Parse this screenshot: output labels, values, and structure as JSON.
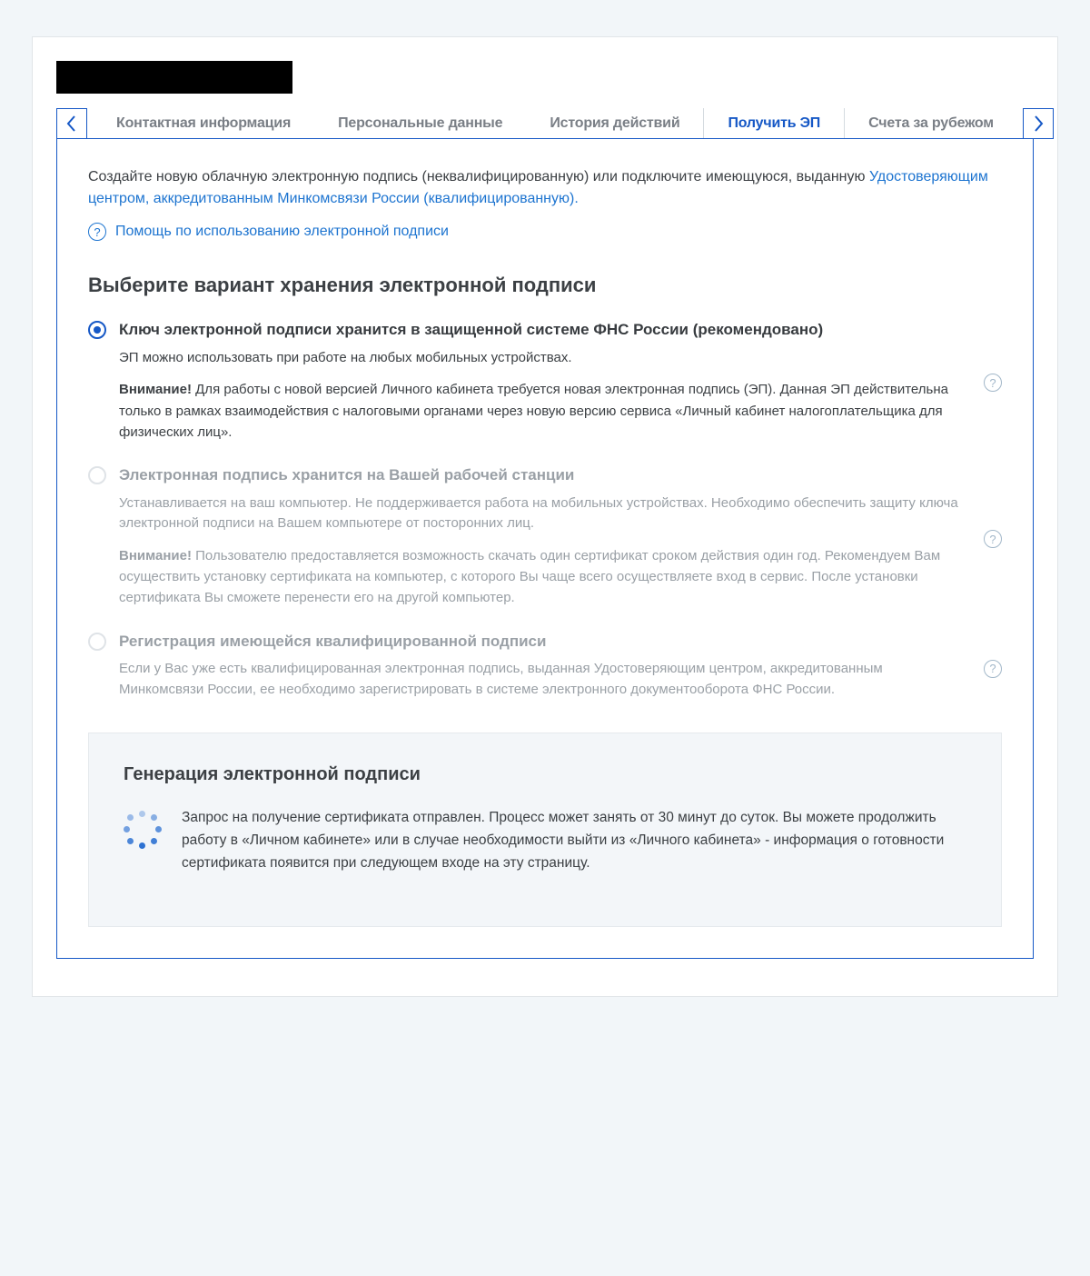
{
  "tabs": {
    "items": [
      {
        "label": "Контактная информация",
        "active": false
      },
      {
        "label": "Персональные данные",
        "active": false
      },
      {
        "label": "История действий",
        "active": false
      },
      {
        "label": "Получить ЭП",
        "active": true
      },
      {
        "label": "Счета за рубежом",
        "active": false
      }
    ]
  },
  "intro": {
    "text1": "Создайте новую облачную электронную подпись (неквалифицированную) или подключите имеющуюся, выданную ",
    "link": "Удостоверяющим центром, аккредитованным Минкомсвязи России (квалифицированную).",
    "help": "Помощь по использованию электронной подписи"
  },
  "section_heading": "Выберите вариант хранения электронной подписи",
  "options": [
    {
      "title": "Ключ электронной подписи хранится в защищенной системе ФНС России (рекомендовано)",
      "desc": "ЭП можно использовать при работе на любых мобильных устройствах.",
      "warn_label": "Внимание!",
      "warn": " Для работы с новой версией Личного кабинета требуется новая электронная подпись (ЭП). Данная ЭП  действительна только в рамках взаимодействия с налоговыми органами через новую версию сервиса  «Личный кабинет налогоплательщика для физических лиц».",
      "selected": true
    },
    {
      "title": "Электронная подпись хранится на Вашей рабочей станции",
      "desc": "Устанавливается на ваш компьютер. Не поддерживается работа на мобильных устройствах. Необходимо обеспечить  защиту ключа электронной подписи на Вашем компьютере от посторонних лиц.",
      "warn_label": "Внимание!",
      "warn": " Пользователю предоставляется возможность скачать один сертификат  сроком действия один год. Рекомендуем Вам осуществить установку сертификата на компьютер, с которого Вы  чаще всего осуществляете вход в сервис. После установки сертификата Вы сможете перенести его на другой компьютер.",
      "selected": false
    },
    {
      "title": "Регистрация имеющейся квалифицированной подписи",
      "desc": "Если у Вас уже есть квалифицированная электронная подпись, выданная Удостоверяющим центром, аккредитованным Минкомсвязи России, ее необходимо зарегистрировать в системе электронного документооборота ФНС России.",
      "warn_label": "",
      "warn": "",
      "selected": false
    }
  ],
  "generation": {
    "title": "Генерация электронной подписи",
    "text": "Запрос на получение сертификата отправлен. Процесс может занять от 30 минут до суток. Вы можете продолжить работу в «Личном кабинете» или в случае необходимости выйти из «Личного кабинета» - информация о готовности сертификата появится при следующем входе на эту страницу."
  }
}
